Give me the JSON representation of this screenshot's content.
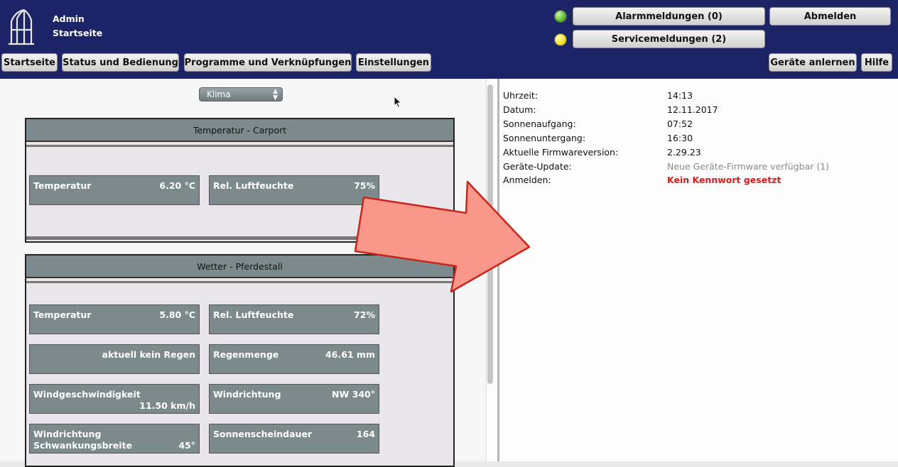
{
  "header": {
    "user": "Admin",
    "page": "Startseite",
    "alarm_button": "Alarmmeldungen (0)",
    "service_button": "Servicemeldungen (2)",
    "logout_button": "Abmelden",
    "alarm_status_color": "#59b72f",
    "service_status_color": "#f0e023"
  },
  "nav": {
    "home": "Startseite",
    "status": "Status und Bedienung",
    "programs": "Programme und Verknüpfungen",
    "settings": "Einstellungen",
    "teach_devices": "Geräte anlernen",
    "help": "Hilfe"
  },
  "filter": {
    "selected": "Klima"
  },
  "panels": {
    "carport": {
      "title": "Temperatur - Carport",
      "temp_label": "Temperatur",
      "temp_value": "6.20 °C",
      "hum_label": "Rel. Luftfeuchte",
      "hum_value": "75%"
    },
    "stall": {
      "title": "Wetter - Pferdestall",
      "temp_label": "Temperatur",
      "temp_value": "5.80 °C",
      "hum_label": "Rel. Luftfeuchte",
      "hum_value": "72%",
      "rain_status": "aktuell kein Regen",
      "rain_label": "Regenmenge",
      "rain_value": "46.61 mm",
      "wind_speed_label": "Windgeschwindigkeit",
      "wind_speed_value": "11.50 km/h",
      "wind_dir_label": "Windrichtung",
      "wind_dir_value": "NW 340°",
      "wind_range_label_1": "Windrichtung",
      "wind_range_label_2": "Schwankungsbreite",
      "wind_range_value": "45°",
      "sun_label": "Sonnenscheindauer",
      "sun_value": "164"
    }
  },
  "info": {
    "time_label": "Uhrzeit:",
    "time_value": "14:13",
    "date_label": "Datum:",
    "date_value": "12.11.2017",
    "sunrise_label": "Sonnenaufgang:",
    "sunrise_value": "07:52",
    "sunset_label": "Sonnenuntergang:",
    "sunset_value": "16:30",
    "firmware_label": "Aktuelle Firmwareversion:",
    "firmware_value": "2.29.23",
    "update_label": "Geräte-Update:",
    "update_value": "Neue Geräte-Firmware verfügbar (1)",
    "login_label": "Anmelden:",
    "login_value": "Kein Kennwort gesetzt"
  },
  "icons": {
    "logo": "house-roof-logo-icon",
    "select_arrows": "updown-arrows-icon",
    "cursor": "mouse-pointer-icon",
    "annotation": "big-right-arrow-icon"
  },
  "colors": {
    "header_bg": "#1c2367",
    "tile_bg": "#7c8a8e",
    "arrow_fill": "#f8978a",
    "alert_text": "#d81a1a"
  }
}
